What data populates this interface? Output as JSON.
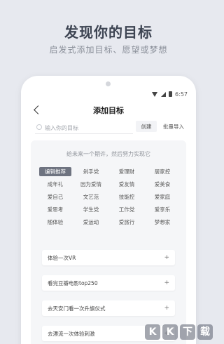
{
  "promo": {
    "headline": "发现你的目标",
    "subheadline": "启发式添加目标、愿望或梦想"
  },
  "status_bar": {
    "time": "6:57"
  },
  "header": {
    "title": "添加目标"
  },
  "search": {
    "placeholder": "输入你的目标",
    "create_label": "创建",
    "bulk_import_label": "批量导入"
  },
  "panel": {
    "prompt": "给未来一个期许，然后努力实现它",
    "tags": [
      "编辑推荐",
      "剁手党",
      "爱理财",
      "居家控",
      "成年礼",
      "因为爱情",
      "爱友情",
      "爱美食",
      "爱自己",
      "文艺范",
      "技能控",
      "爱家庭",
      "爱思考",
      "学生党",
      "工作党",
      "爱享乐",
      "随体验",
      "爱运动",
      "爱旅行",
      "梦想家"
    ],
    "selected_tag": "编辑推荐",
    "goals": [
      "体验一次VR",
      "看完豆瓣电影top250",
      "去天安门看一次升旗仪式",
      "去漂流一次体验刺激"
    ]
  },
  "watermark": {
    "chars": [
      "K",
      "K",
      "下",
      "载"
    ]
  }
}
